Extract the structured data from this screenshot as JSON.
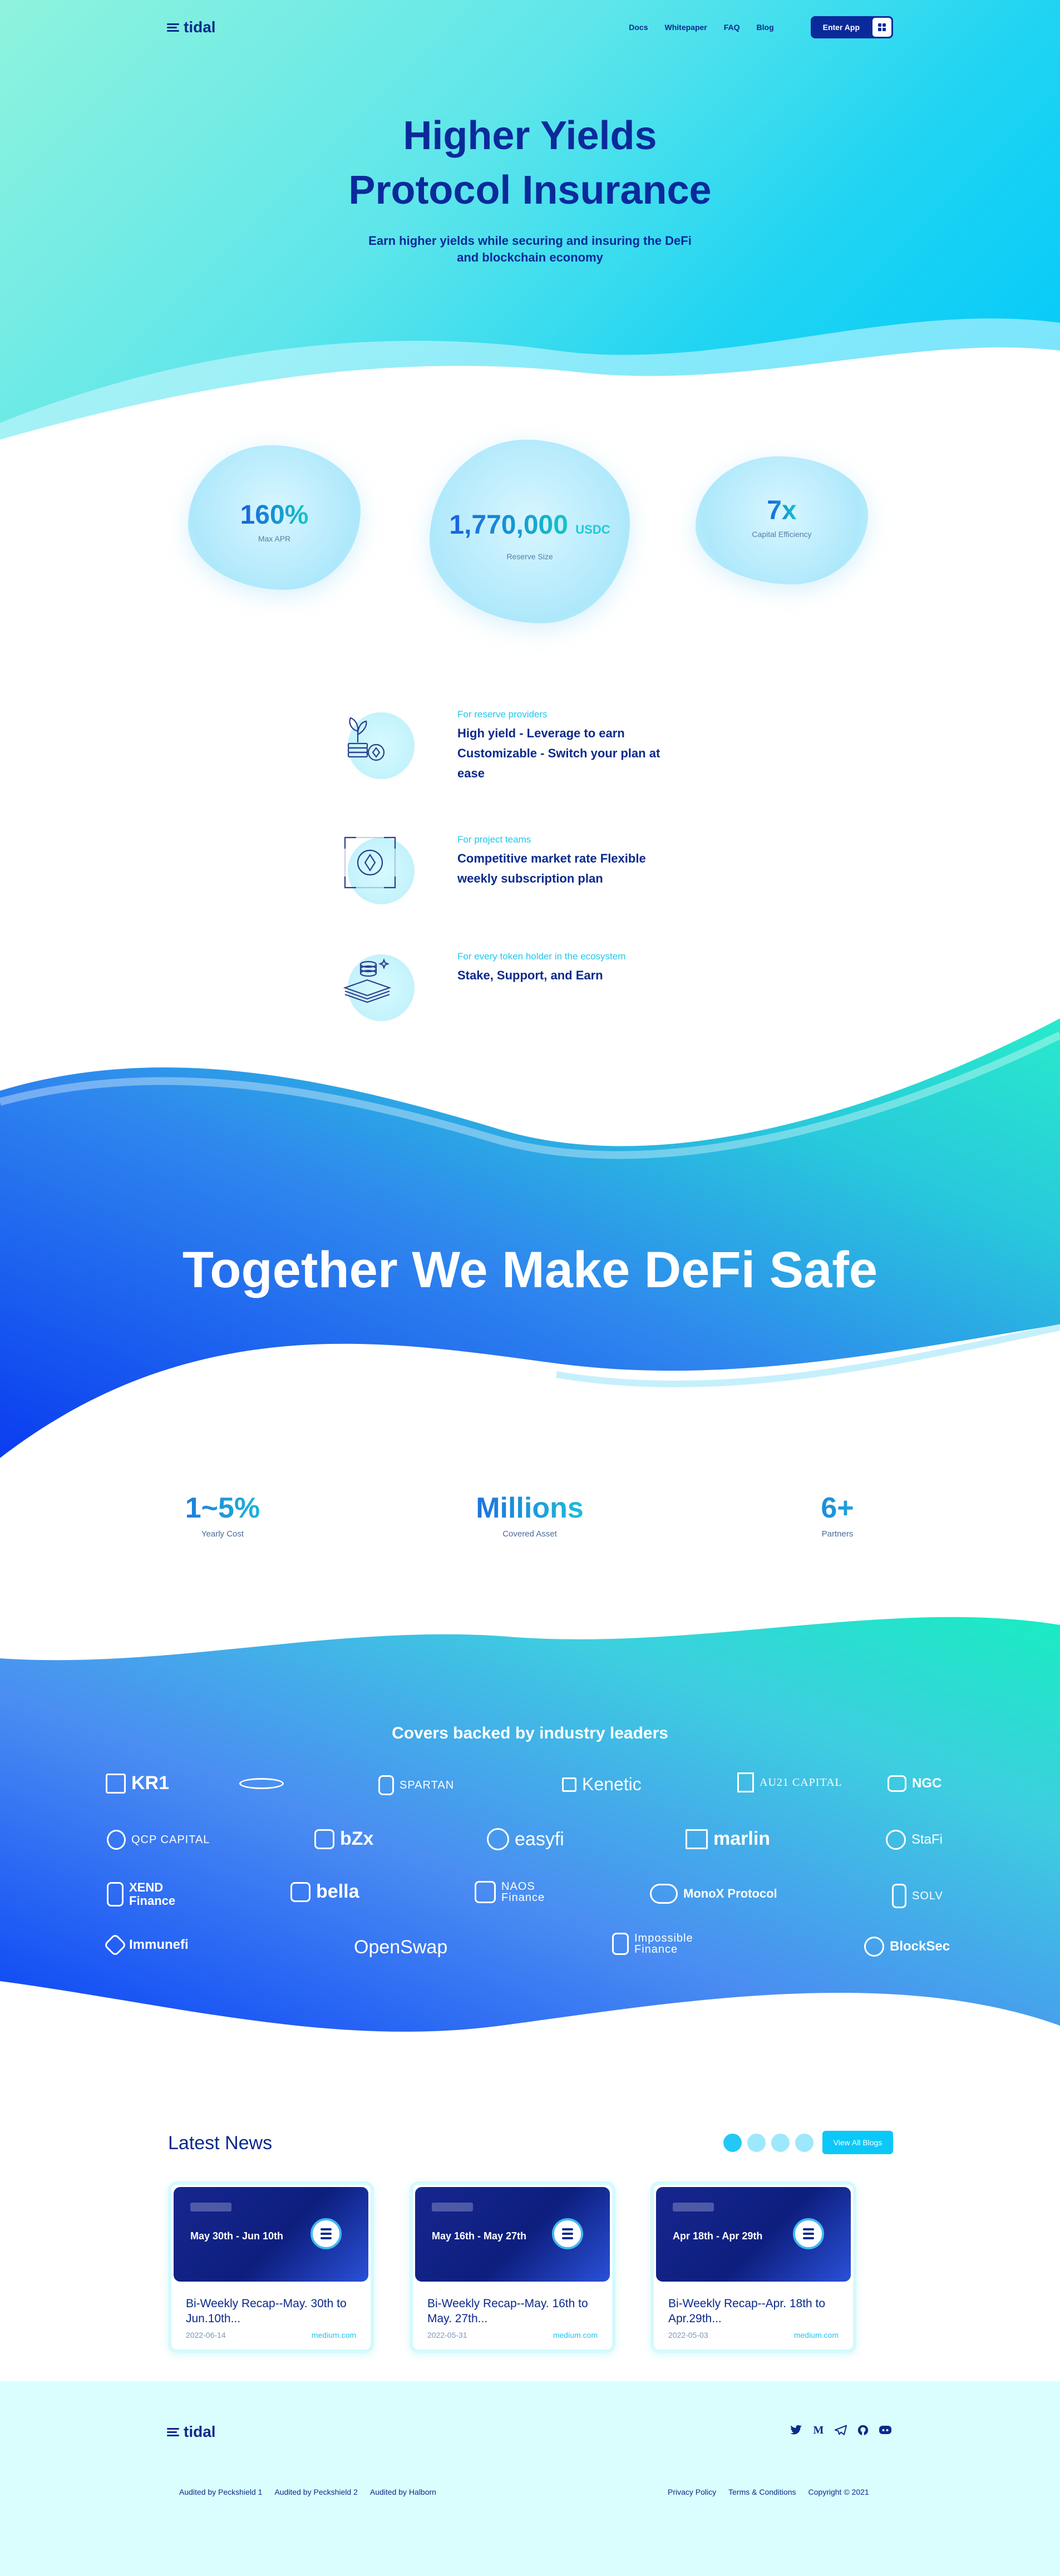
{
  "brand": {
    "name": "tidal"
  },
  "nav": {
    "links": [
      "Docs",
      "Whitepaper",
      "FAQ",
      "Blog"
    ],
    "enter_app": "Enter App"
  },
  "hero": {
    "title_line1": "Higher Yields",
    "title_line2": "Protocol Insurance",
    "subtitle_line1": "Earn higher yields while securing and insuring the DeFi",
    "subtitle_line2": "and blockchain economy"
  },
  "stats": [
    {
      "value": "160%",
      "unit": "",
      "label": "Max APR"
    },
    {
      "value": "1,770,000",
      "unit": "USDC",
      "label": "Reserve Size"
    },
    {
      "value": "7x",
      "unit": "",
      "label": "Capital Efficiency"
    }
  ],
  "features": [
    {
      "tag": "For reserve providers",
      "lines": [
        "High yield - Leverage to earn",
        "Customizable - Switch your plan at",
        "ease"
      ]
    },
    {
      "tag": "For project teams",
      "lines": [
        "Competitive market rate Flexible",
        "weekly subscription plan"
      ]
    },
    {
      "tag": "For every token holder in the ecosystem",
      "lines": [
        "Stake, Support, and Earn"
      ]
    }
  ],
  "together": {
    "title": "Together We Make DeFi Safe"
  },
  "metrics": [
    {
      "value": "1~5%",
      "label": "Yearly Cost"
    },
    {
      "value": "Millions",
      "label": "Covered Asset"
    },
    {
      "value": "6+",
      "label": "Partners"
    }
  ],
  "partners": {
    "title": "Covers backed by industry leaders",
    "items": [
      "KR1",
      "HYPERSPHERE",
      "SPARTAN",
      "Kenetic",
      "AU21 CAPITAL",
      "NGC",
      "QCP CAPITAL",
      "bZx",
      "easyfi",
      "marlin",
      "StaFi",
      "XEND Finance",
      "bella",
      "NAOS Finance",
      "MonoX Protocol",
      "SOLV",
      "Immunefi",
      "OpenSwap",
      "Impossible Finance",
      "BlockSec"
    ]
  },
  "news": {
    "title": "Latest News",
    "view_all": "View All Blogs",
    "cards": [
      {
        "banner": "May 30th - Jun 10th",
        "headline": "Bi-Weekly Recap--May. 30th to Jun.10th...",
        "date": "2022-06-14",
        "source": "medium.com"
      },
      {
        "banner": "May 16th - May 27th",
        "headline": "Bi-Weekly Recap--May. 16th to May. 27th...",
        "date": "2022-05-31",
        "source": "medium.com"
      },
      {
        "banner": "Apr 18th - Apr 29th",
        "headline": "Bi-Weekly Recap--Apr. 18th to Apr.29th...",
        "date": "2022-05-03",
        "source": "medium.com"
      }
    ]
  },
  "footer": {
    "socials": [
      "twitter-icon",
      "medium-icon",
      "telegram-icon",
      "github-icon",
      "discord-icon"
    ],
    "audits": [
      "Audited by Peckshield 1",
      "Audited by Peckshield 2",
      "Audited by Halborn"
    ],
    "legal": [
      "Privacy Policy",
      "Terms & Conditions",
      "Copyright © 2021"
    ]
  }
}
